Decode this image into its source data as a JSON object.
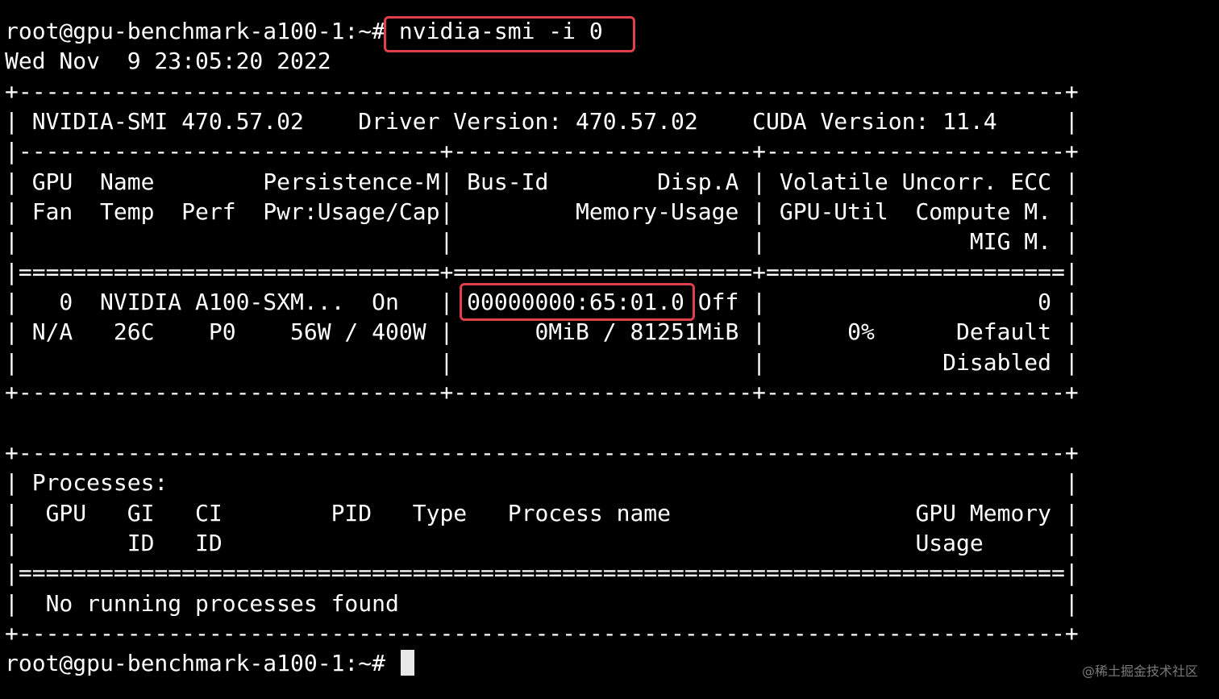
{
  "terminal": {
    "prompt": "root@gpu-benchmark-a100-1:~# ",
    "command": "nvidia-smi -i 0",
    "lines": [
      "Wed Nov  9 23:05:20 2022",
      "+-----------------------------------------------------------------------------+",
      "| NVIDIA-SMI 470.57.02    Driver Version: 470.57.02    CUDA Version: 11.4     |",
      "|-------------------------------+----------------------+----------------------+",
      "| GPU  Name        Persistence-M| Bus-Id        Disp.A | Volatile Uncorr. ECC |",
      "| Fan  Temp  Perf  Pwr:Usage/Cap|         Memory-Usage | GPU-Util  Compute M. |",
      "|                               |                      |               MIG M. |",
      "|===============================+======================+======================|",
      "|   0  NVIDIA A100-SXM...  On   | 00000000:65:01.0 Off |                    0 |",
      "| N/A   26C    P0    56W / 400W |      0MiB / 81251MiB |      0%      Default |",
      "|                               |                      |             Disabled |",
      "+-------------------------------+----------------------+----------------------+",
      "",
      "+-----------------------------------------------------------------------------+",
      "| Processes:                                                                  |",
      "|  GPU   GI   CI        PID   Type   Process name                  GPU Memory |",
      "|        ID   ID                                                   Usage      |",
      "|=============================================================================|",
      "|  No running processes found                                                 |",
      "+-----------------------------------------------------------------------------+"
    ],
    "final_prompt": "root@gpu-benchmark-a100-1:~# "
  },
  "watermark": "@稀土掘金技术社区",
  "colors": {
    "background": "#000000",
    "text": "#ffffff",
    "highlight_border": "#e0404a",
    "cursor": "#e8e8e8"
  }
}
